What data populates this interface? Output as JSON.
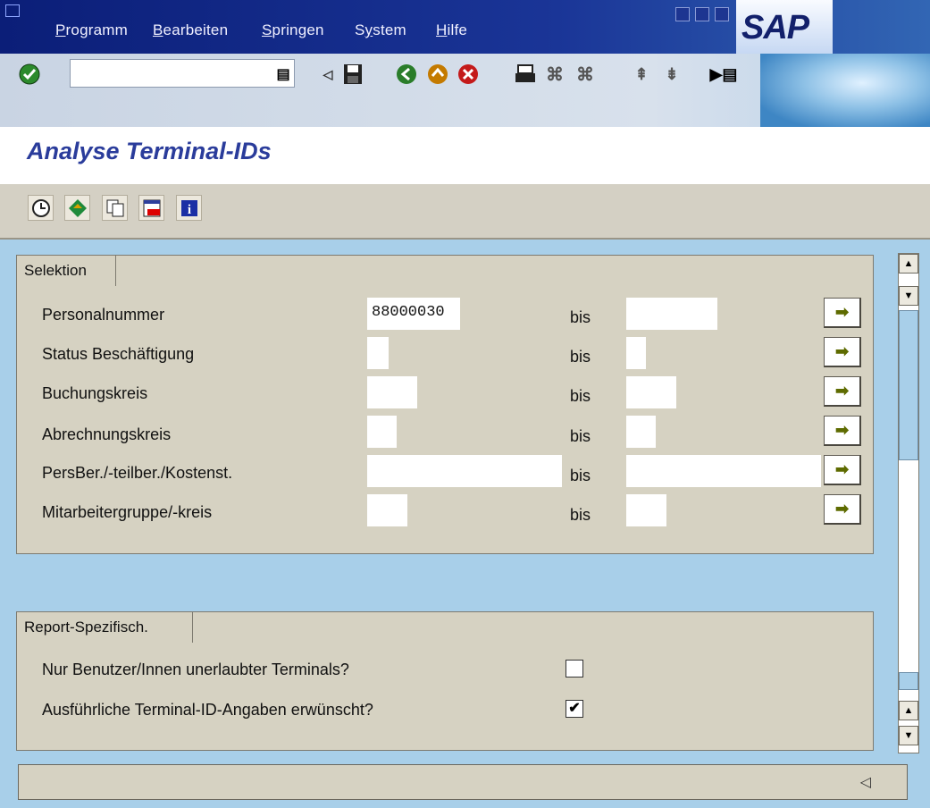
{
  "menu": {
    "items": [
      "Programm",
      "Bearbeiten",
      "Springen",
      "System",
      "Hilfe"
    ],
    "mnemonics": [
      "P",
      "B",
      "S",
      "y",
      "H"
    ]
  },
  "brand": {
    "logo_text": "SAP"
  },
  "command_field": {
    "value": ""
  },
  "page": {
    "title": "Analyse Terminal-IDs"
  },
  "selection": {
    "group_title": "Selektion",
    "bis_label": "bis",
    "rows": [
      {
        "label": "Personalnummer",
        "from": "88000030",
        "to": ""
      },
      {
        "label": "Status Beschäftigung",
        "from": "",
        "to": ""
      },
      {
        "label": "Buchungskreis",
        "from": "",
        "to": ""
      },
      {
        "label": "Abrechnungskreis",
        "from": "",
        "to": ""
      },
      {
        "label": "PersBer./-teilber./Kostenst.",
        "from": "",
        "to": ""
      },
      {
        "label": "Mitarbeitergruppe/-kreis",
        "from": "",
        "to": ""
      }
    ]
  },
  "report": {
    "group_title": "Report-Spezifisch.",
    "options": [
      {
        "label": "Nur Benutzer/Innen unerlaubter Terminals?",
        "checked": false
      },
      {
        "label": "Ausführliche Terminal-ID-Angaben erwünscht?",
        "checked": true
      }
    ]
  },
  "colors": {
    "title_blue": "#2a3c9b",
    "menubar": "#0b1e78",
    "background": "#a8cfe9"
  },
  "icons": {
    "toolbar": [
      "enter-icon",
      "command-history-icon",
      "back-arrow-icon",
      "save-icon",
      "back-icon",
      "exit-icon",
      "cancel-icon",
      "print-icon",
      "find-icon",
      "find-next-icon",
      "first-page-icon",
      "last-page-icon",
      "create-session-icon"
    ],
    "apptoolbar": [
      "execute-icon",
      "get-variant-icon",
      "copy-icon",
      "delete-icon",
      "info-icon"
    ]
  }
}
